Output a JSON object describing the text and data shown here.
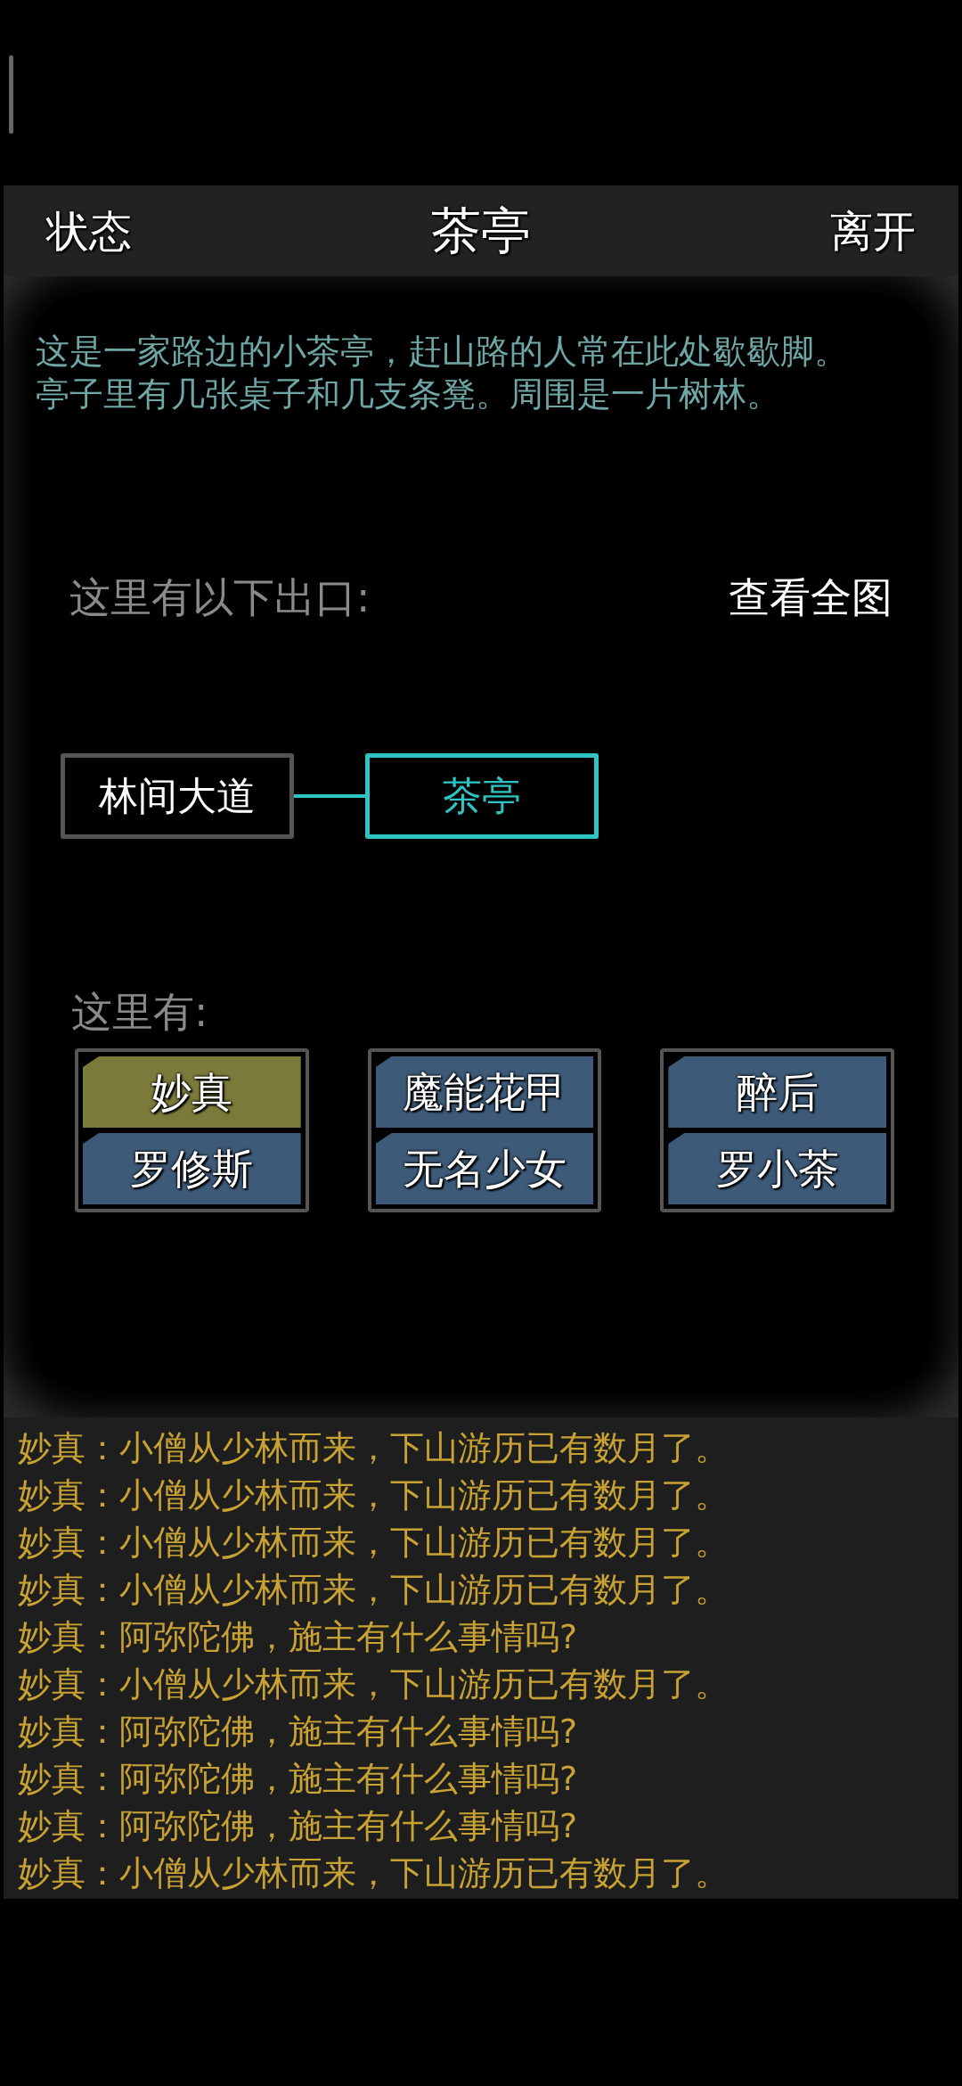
{
  "header": {
    "left_button": "状态",
    "title": "茶亭",
    "right_button": "离开"
  },
  "description": [
    "这是一家路边的小茶亭，赶山路的人常在此处歇歇脚。",
    "亭子里有几张桌子和几支条凳。周围是一片树林。"
  ],
  "exits": {
    "label": "这里有以下出口:",
    "map_button": "查看全图"
  },
  "map": {
    "rooms": [
      {
        "name": "林间大道",
        "selected": false
      },
      {
        "name": "茶亭",
        "selected": true
      }
    ]
  },
  "npcs": {
    "label": "这里有:",
    "items": [
      {
        "name": "妙真",
        "selected": true
      },
      {
        "name": "魔能花甲",
        "selected": false
      },
      {
        "name": "醉后",
        "selected": false
      },
      {
        "name": "罗修斯",
        "selected": false
      },
      {
        "name": "无名少女",
        "selected": false
      },
      {
        "name": "罗小茶",
        "selected": false
      }
    ]
  },
  "log": [
    "妙真：小僧从少林而来，下山游历已有数月了。",
    "妙真：小僧从少林而来，下山游历已有数月了。",
    "妙真：小僧从少林而来，下山游历已有数月了。",
    "妙真：小僧从少林而来，下山游历已有数月了。",
    "妙真：阿弥陀佛，施主有什么事情吗?",
    "妙真：小僧从少林而来，下山游历已有数月了。",
    "妙真：阿弥陀佛，施主有什么事情吗?",
    "妙真：阿弥陀佛，施主有什么事情吗?",
    "妙真：阿弥陀佛，施主有什么事情吗?",
    "妙真：小僧从少林而来，下山游历已有数月了。"
  ]
}
